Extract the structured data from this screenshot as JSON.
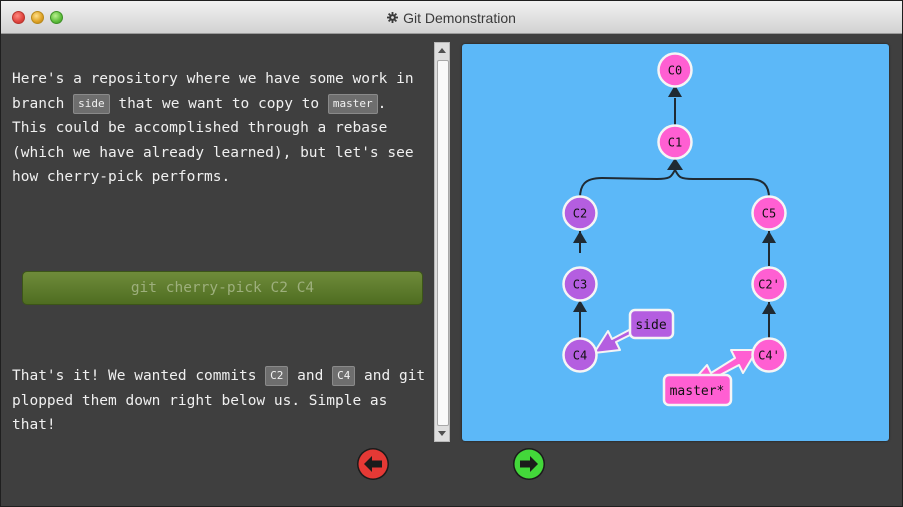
{
  "window": {
    "title": "Git Demonstration",
    "title_icon": "gear-icon"
  },
  "intro": {
    "part1": "Here's a repository where we have some work in branch ",
    "branch_side": "side",
    "part2": " that we want to copy to ",
    "branch_master": "master",
    "part3": ". This could be accomplished through a rebase (which we have already learned), but let's see how cherry-pick performs."
  },
  "command_button": {
    "label": "git cherry-pick C2 C4"
  },
  "outro": {
    "part1": "That's it! We wanted commits ",
    "commit_c2": "C2",
    "part2": " and ",
    "commit_c4": "C4",
    "part3": " and git plopped them down right below us. Simple as that!"
  },
  "graph": {
    "colors": {
      "background": "#5cb8f8",
      "pink_commit": "#ff5fd2",
      "purple_commit": "#b45ee0",
      "edge": "#1f2a33"
    },
    "commits": {
      "c0": "C0",
      "c1": "C1",
      "c2": "C2",
      "c3": "C3",
      "c4": "C4",
      "c5": "C5",
      "c2p": "C2'",
      "c4p": "C4'"
    },
    "branches": {
      "side": "side",
      "master": "master*"
    }
  },
  "navigation": {
    "back_icon": "arrow-left-icon",
    "forward_icon": "arrow-right-icon",
    "back_color": "#e53935",
    "forward_color": "#43d83a"
  }
}
